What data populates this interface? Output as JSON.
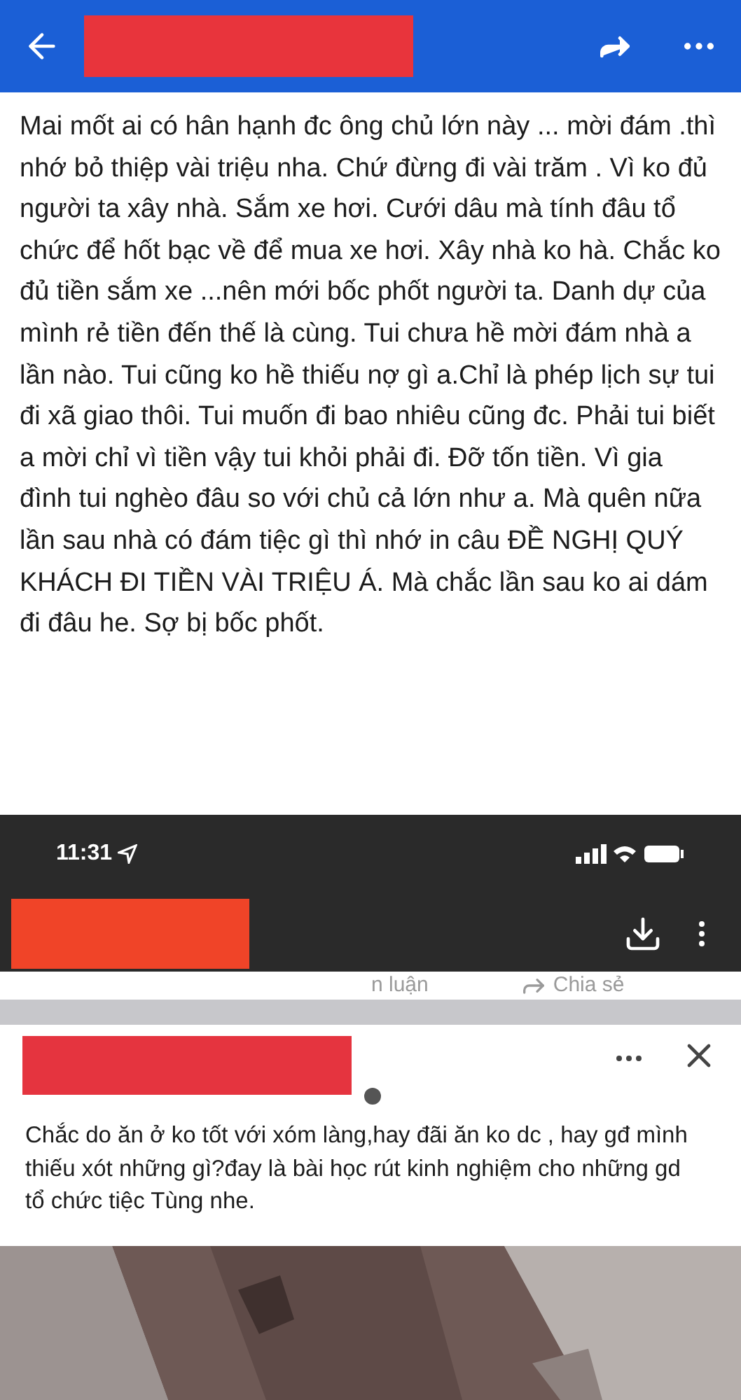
{
  "post": {
    "text": "Mai mốt ai có hân hạnh đc ông chủ lớn này ... mời đám .thì nhớ bỏ thiệp vài triệu nha. Chứ đừng đi vài trăm . Vì ko đủ người ta xây nhà. Sắm xe hơi. Cưới dâu mà tính đâu tổ chức để hốt bạc về để mua xe hơi. Xây nhà ko hà.  Chắc ko đủ tiền sắm xe ...nên mới bốc phốt người ta. Danh dự của mình rẻ tiền đến thế là cùng. Tui chưa hề mời đám nhà a lần nào. Tui cũng ko hề thiếu nợ gì a.Chỉ là phép lịch sự tui đi xã giao thôi. Tui muốn đi bao nhiêu cũng đc. Phải tui biết a mời chỉ vì tiền vậy tui khỏi phải đi. Đỡ tốn tiền. Vì gia đình tui nghèo đâu so với chủ cả lớn như a. Mà quên nữa lần sau nhà có đám tiệc gì thì nhớ in câu ĐỀ NGHỊ QUÝ KHÁCH ĐI TIỀN VÀI TRIỆU Á. Mà chắc lần sau ko ai dám đi đâu he. Sợ bị bốc phốt."
  },
  "status_bar": {
    "time": "11:31"
  },
  "action_bar": {
    "comment_label": "n luận",
    "share_label": "Chia sẻ"
  },
  "comment": {
    "text": "Chắc do ăn ở ko tốt với xóm làng,hay đãi ăn ko dc , hay gđ mình thiếu xót những gì?đay là bài học rút kinh nghiệm cho những gd tổ chức tiệc Tùng nhe."
  }
}
